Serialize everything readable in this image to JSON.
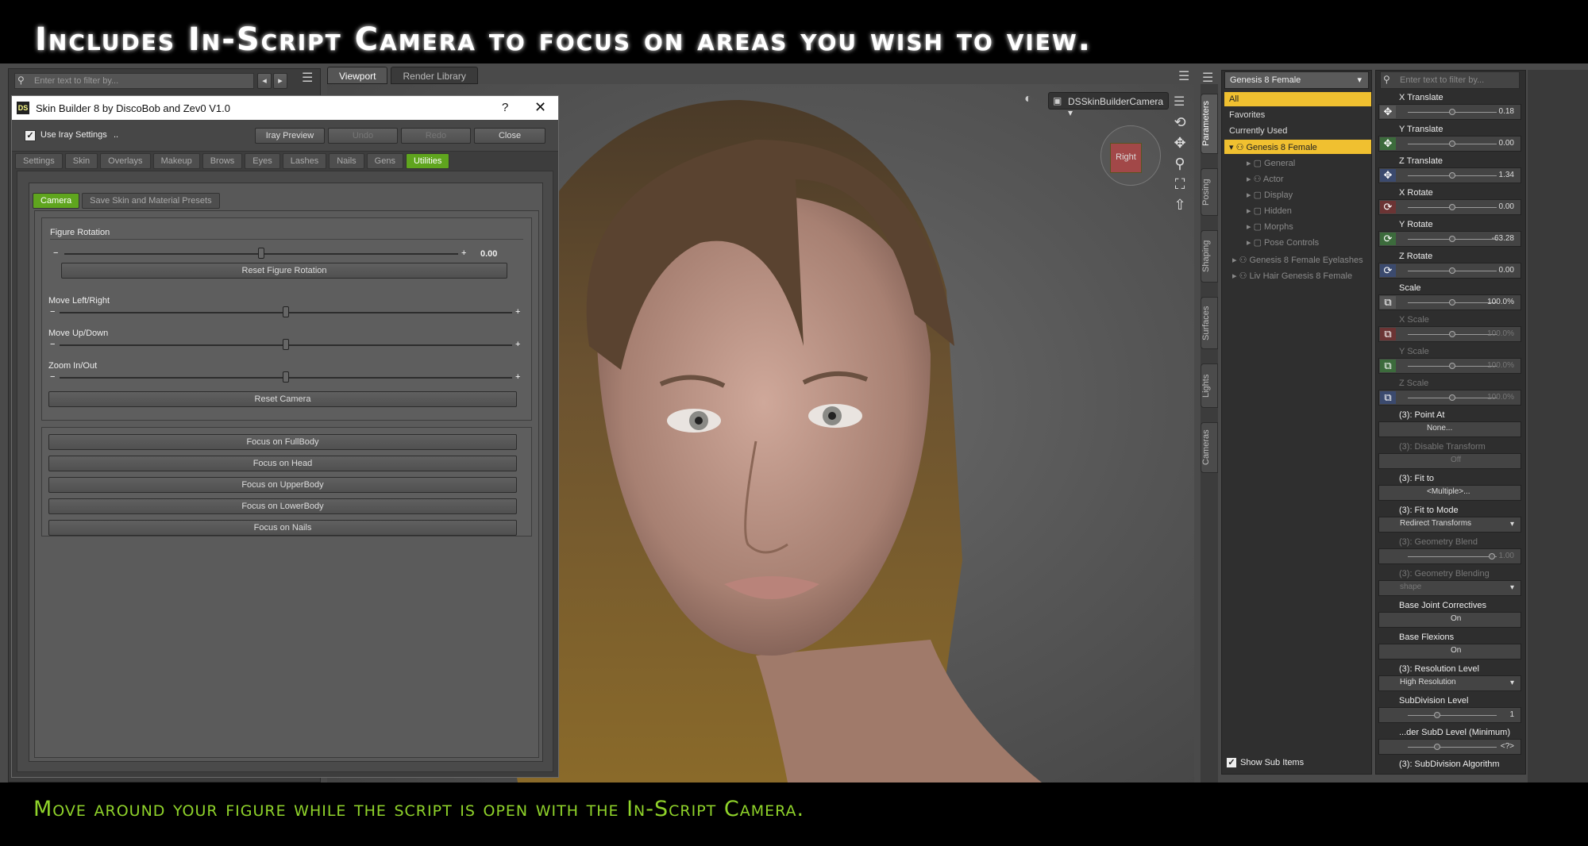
{
  "banner": {
    "top": "Includes In-Script Camera to focus on areas you wish to view.",
    "bottom": "Move around your figure while the script is open with the In-Script Camera."
  },
  "left_filter_placeholder": "Enter text to filter by...",
  "viewport": {
    "tabs": [
      "Viewport",
      "Render Library"
    ],
    "camera": "DSSkinBuilderCamera",
    "cube_face": "Right"
  },
  "dialog": {
    "logo": "DS",
    "title": "Skin Builder 8 by DiscoBob and Zev0 V1.0",
    "help": "?",
    "close": "✕",
    "use_iray": "Use Iray Settings",
    "use_iray_extra": "..",
    "buttons": {
      "iray_preview": "Iray Preview",
      "undo": "Undo",
      "redo": "Redo",
      "close": "Close"
    },
    "tabs": [
      "Settings",
      "Skin",
      "Overlays",
      "Makeup",
      "Brows",
      "Eyes",
      "Lashes",
      "Nails",
      "Gens",
      "Utilities"
    ],
    "sub_tabs": [
      "Camera",
      "Save Skin and Material Presets"
    ],
    "figure_rotation": {
      "label": "Figure Rotation",
      "value": "0.00",
      "level": 0.5,
      "reset": "Reset Figure Rotation"
    },
    "move_lr": {
      "label": "Move Left/Right",
      "level": 0.5
    },
    "move_ud": {
      "label": "Move Up/Down",
      "level": 0.5
    },
    "zoom": {
      "label": "Zoom In/Out",
      "level": 0.5
    },
    "reset_camera": "Reset Camera",
    "focus_buttons": [
      "Focus on FullBody",
      "Focus on Head",
      "Focus on UpperBody",
      "Focus on LowerBody",
      "Focus on Nails"
    ]
  },
  "side_tabs": [
    "Parameters",
    "Posing",
    "Shaping",
    "Surfaces",
    "Lights",
    "Cameras"
  ],
  "scene": {
    "select": "Genesis 8 Female",
    "rows": [
      {
        "label": "All",
        "state": "hl"
      },
      {
        "label": "Favorites",
        "state": ""
      },
      {
        "label": "Currently Used",
        "state": ""
      },
      {
        "label": "Genesis 8 Female",
        "state": "hl"
      },
      {
        "label": "General",
        "state": "dim"
      },
      {
        "label": "Actor",
        "state": "dim"
      },
      {
        "label": "Display",
        "state": "dim"
      },
      {
        "label": "Hidden",
        "state": "dim"
      },
      {
        "label": "Morphs",
        "state": "dim"
      },
      {
        "label": "Pose Controls",
        "state": "dim"
      },
      {
        "label": "Genesis 8 Female Eyelashes",
        "state": "dim"
      },
      {
        "label": "Liv Hair Genesis 8 Female",
        "state": "dim"
      }
    ],
    "show_sub": "Show Sub Items"
  },
  "param_filter_placeholder": "Enter text to filter by...",
  "params": [
    {
      "label": "X Translate",
      "value": "0.18",
      "icon": "move-icon",
      "color": "#555555",
      "kind": "slider",
      "level": 0.5
    },
    {
      "label": "Y Translate",
      "value": "0.00",
      "icon": "move-icon",
      "color": "#3c6b3c",
      "kind": "slider",
      "level": 0.5
    },
    {
      "label": "Z Translate",
      "value": "1.34",
      "icon": "move-icon",
      "color": "#3b4a6e",
      "kind": "slider",
      "level": 0.5
    },
    {
      "label": "X Rotate",
      "value": "0.00",
      "icon": "rotate-icon",
      "color": "#6b3434",
      "kind": "slider",
      "level": 0.5
    },
    {
      "label": "Y Rotate",
      "value": "-63.28",
      "icon": "rotate-icon",
      "color": "#3c6b3c",
      "kind": "slider",
      "level": 0.5
    },
    {
      "label": "Z Rotate",
      "value": "0.00",
      "icon": "rotate-icon",
      "color": "#3b4a6e",
      "kind": "slider",
      "level": 0.5
    },
    {
      "label": "Scale",
      "value": "100.0%",
      "icon": "scale-icon",
      "color": "#555555",
      "kind": "slider",
      "level": 0.5
    },
    {
      "label": "X Scale",
      "value": "100.0%",
      "icon": "scale-icon",
      "color": "#6b3434",
      "kind": "slider",
      "level": 0.5,
      "dim": true
    },
    {
      "label": "Y Scale",
      "value": "100.0%",
      "icon": "scale-icon",
      "color": "#3c6b3c",
      "kind": "slider",
      "level": 0.5,
      "dim": true
    },
    {
      "label": "Z Scale",
      "value": "100.0%",
      "icon": "scale-icon",
      "color": "#3b4a6e",
      "kind": "slider",
      "level": 0.5,
      "dim": true
    },
    {
      "label": "(3): Point At",
      "value": "None...",
      "kind": "field"
    },
    {
      "label": "(3): Disable Transform",
      "value": "Off",
      "kind": "toggle",
      "dim": true
    },
    {
      "label": "(3): Fit to",
      "value": "<Multiple>...",
      "kind": "field"
    },
    {
      "label": "(3): Fit to Mode",
      "value": "Redirect Transforms",
      "kind": "select"
    },
    {
      "label": "(3): Geometry Blend",
      "value": "1.00",
      "kind": "slider",
      "level": 0.95,
      "dim": true
    },
    {
      "label": "(3): Geometry Blending",
      "value": "shape",
      "kind": "select",
      "dim": true
    },
    {
      "label": "Base Joint Correctives",
      "value": "On",
      "kind": "toggle"
    },
    {
      "label": "Base Flexions",
      "value": "On",
      "kind": "toggle"
    },
    {
      "label": "(3): Resolution Level",
      "value": "High Resolution",
      "kind": "select"
    },
    {
      "label": "SubDivision Level",
      "value": "1",
      "kind": "slider",
      "level": 0.33
    },
    {
      "label": "...der SubD Level (Minimum)",
      "value": "<?>",
      "kind": "slider",
      "level": 0.33
    },
    {
      "label": "(3): SubDivision Algorithm",
      "value": "",
      "kind": "label"
    }
  ]
}
